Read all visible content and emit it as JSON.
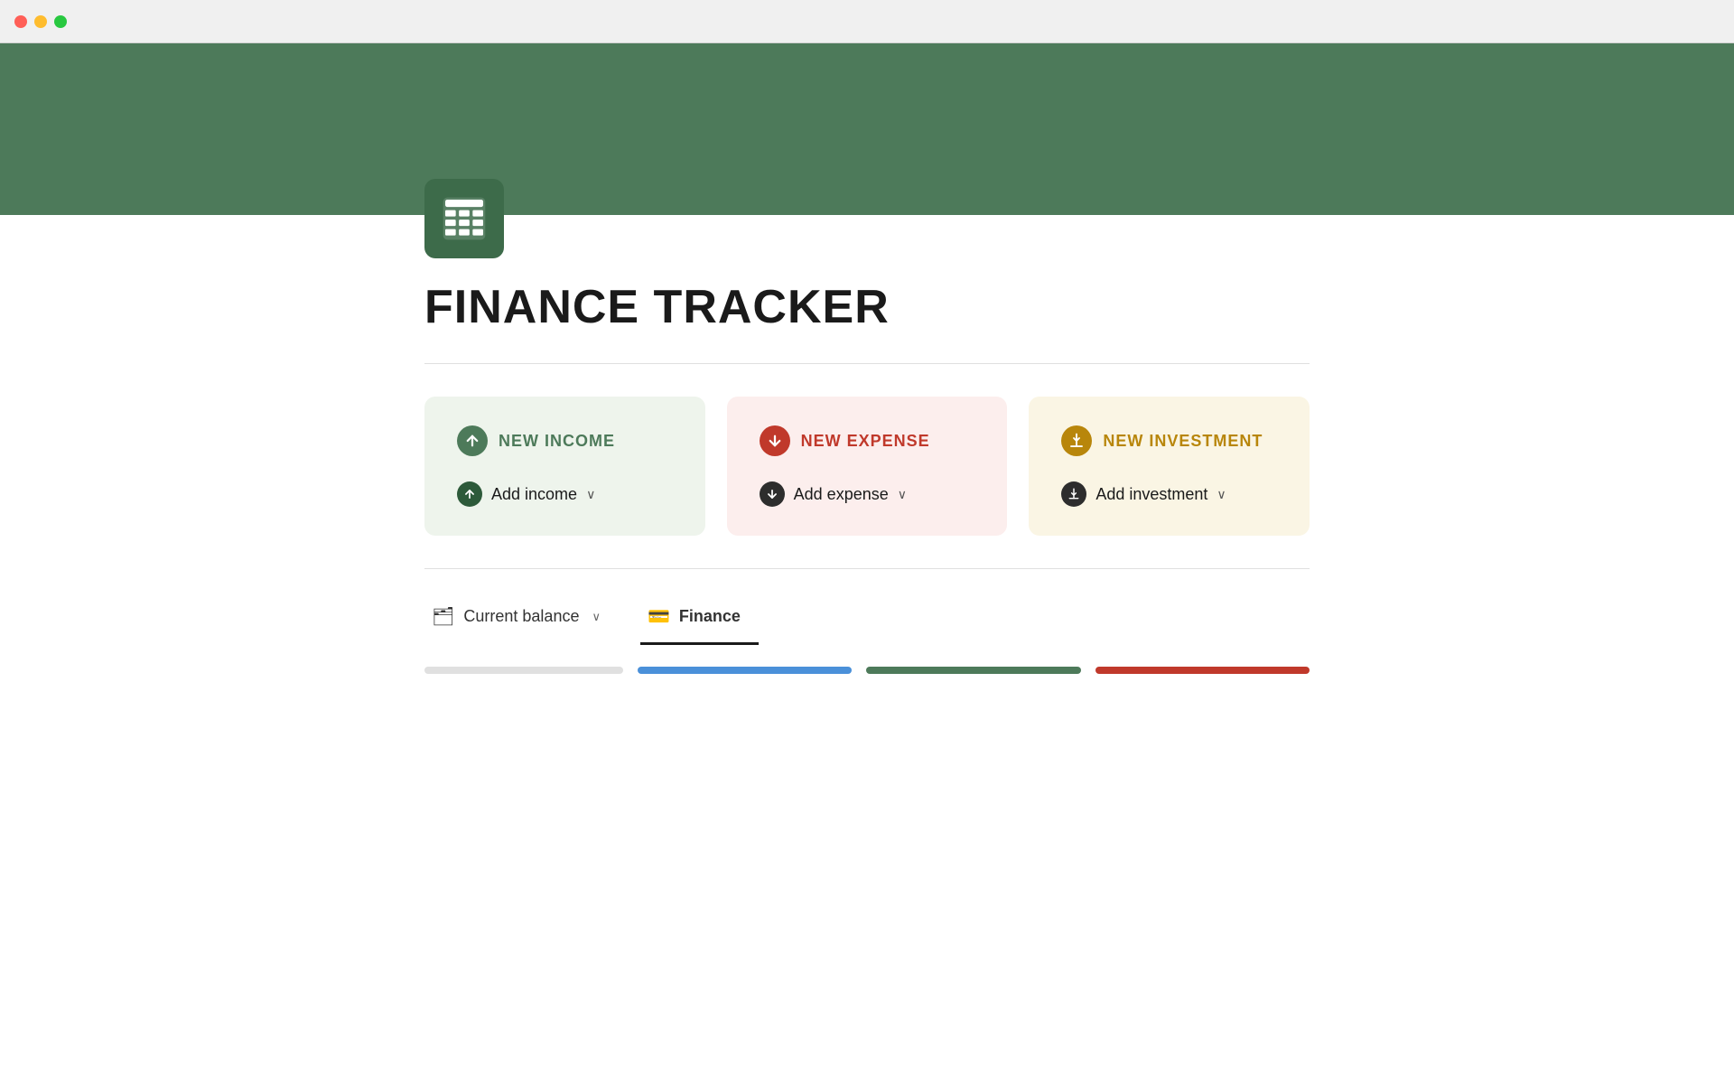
{
  "titlebar": {
    "buttons": [
      "close",
      "minimize",
      "maximize"
    ]
  },
  "header": {
    "banner_color": "#4d7a5a"
  },
  "app_icon": {
    "alt": "Spreadsheet icon"
  },
  "page": {
    "title": "FINANCE TRACKER"
  },
  "cards": [
    {
      "id": "income",
      "title": "NEW INCOME",
      "action_label": "Add income",
      "icon_symbol": "↑",
      "color_class": "income"
    },
    {
      "id": "expense",
      "title": "NEW EXPENSE",
      "action_label": "Add expense",
      "icon_symbol": "↓",
      "color_class": "expense"
    },
    {
      "id": "investment",
      "title": "NEW INVESTMENT",
      "action_label": "Add investment",
      "icon_symbol": "⬇",
      "color_class": "investment"
    }
  ],
  "tabs": [
    {
      "id": "current-balance",
      "label": "Current balance",
      "icon": "🗂",
      "active": false
    },
    {
      "id": "finance",
      "label": "Finance",
      "icon": "💳",
      "active": true
    }
  ]
}
